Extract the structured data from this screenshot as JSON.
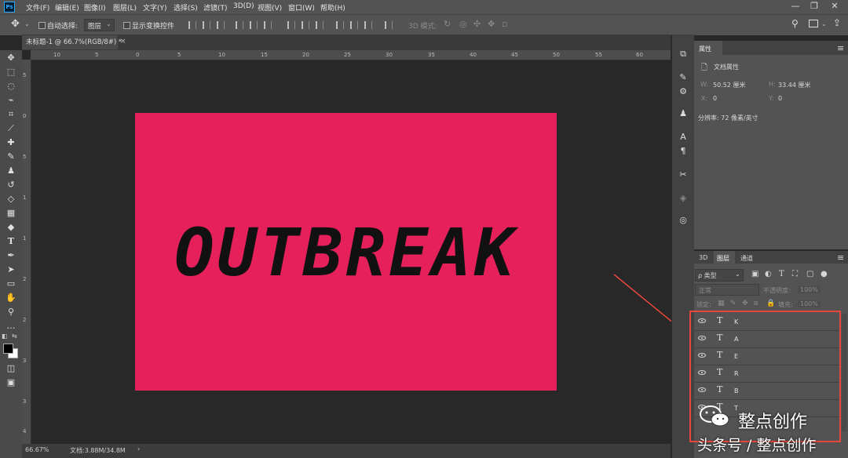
{
  "app": {
    "logo_text": "Ps"
  },
  "menu": [
    "文件(F)",
    "编辑(E)",
    "图像(I)",
    "图层(L)",
    "文字(Y)",
    "选择(S)",
    "滤镜(T)",
    "3D(D)",
    "视图(V)",
    "窗口(W)",
    "帮助(H)"
  ],
  "window_controls": {
    "minimize": "—",
    "restore": "❐",
    "close": "✕"
  },
  "options": {
    "auto_select_label": "自动选择:",
    "auto_select_value": "图层",
    "show_transform_label": "显示变换控件",
    "mode_3d_label": "3D 模式:"
  },
  "document": {
    "tab_title": "未标题-1 @ 66.7%(RGB/8#) *",
    "close": "×",
    "canvas_text": "OUTBREAK",
    "canvas_color": "#e5205b"
  },
  "rulers": {
    "top": [
      "10",
      "5",
      "0",
      "5",
      "10",
      "15",
      "20",
      "25",
      "30",
      "35",
      "40",
      "45",
      "50",
      "55",
      "60"
    ],
    "left": [
      "5",
      "0",
      "5",
      "1",
      "1",
      "2",
      "2",
      "3",
      "3",
      "4"
    ]
  },
  "status": {
    "zoom": "66.67%",
    "doc_info": "文档:3.88M/34.8M"
  },
  "properties": {
    "tab": "属性",
    "section": "文档属性",
    "w_label": "W:",
    "w_value": "50.52 厘米",
    "h_label": "H:",
    "h_value": "33.44 厘米",
    "x_label": "X:",
    "x_value": "0",
    "y_label": "Y:",
    "y_value": "0",
    "resolution": "分辨率: 72 像素/英寸"
  },
  "layers_panel": {
    "tabs": [
      "3D",
      "图层",
      "通道"
    ],
    "filter_kind": "ρ 类型",
    "blend_mode": "正常",
    "opacity_label": "不透明度:",
    "opacity_value": "100%",
    "lock_label": "锁定:",
    "fill_label": "填充:",
    "fill_value": "100%",
    "layers": [
      {
        "type": "T",
        "name": "K"
      },
      {
        "type": "T",
        "name": "A"
      },
      {
        "type": "T",
        "name": "E"
      },
      {
        "type": "T",
        "name": "R"
      },
      {
        "type": "T",
        "name": "B"
      },
      {
        "type": "T",
        "name": "T"
      }
    ]
  },
  "watermark": {
    "line1": "整点创作",
    "line2": "头条号 / 整点创作"
  },
  "colors": {
    "annotation": "#e8473b",
    "ui_dark": "#535353",
    "canvas_bg": "#282828"
  }
}
